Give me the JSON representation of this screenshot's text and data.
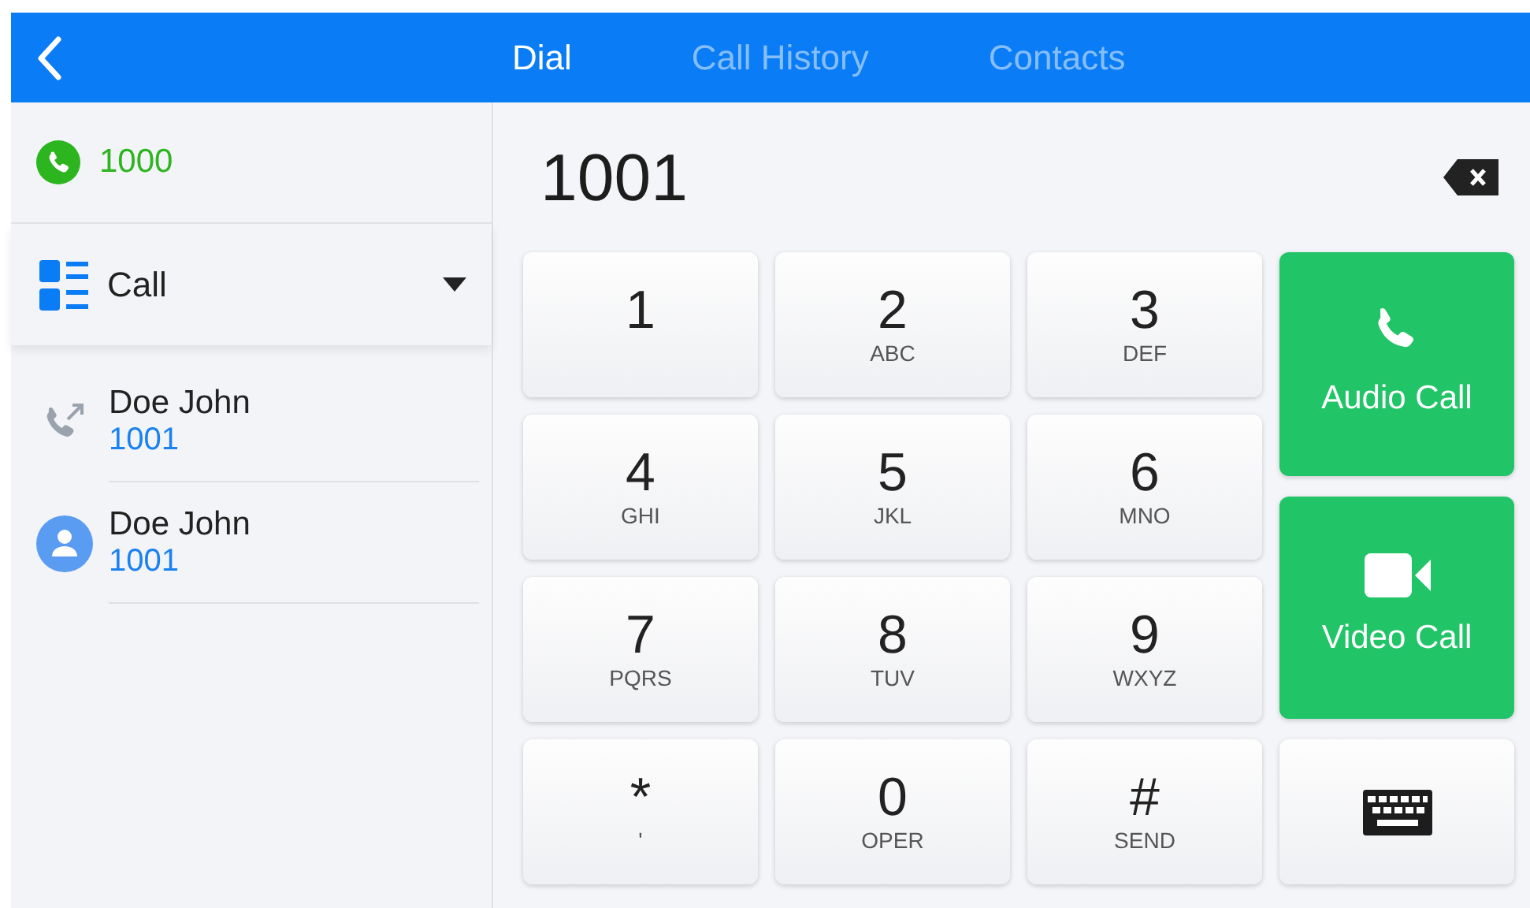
{
  "tabs": [
    {
      "label": "Dial",
      "selected": true
    },
    {
      "label": "Call History",
      "selected": false
    },
    {
      "label": "Contacts",
      "selected": false
    }
  ],
  "account": {
    "number": "1000"
  },
  "mode": {
    "label": "Call"
  },
  "recent": [
    {
      "kind": "history",
      "name": "Doe John",
      "number": "1001"
    },
    {
      "kind": "contact",
      "name": "Doe John",
      "number": "1001"
    }
  ],
  "dial_input": {
    "value": "1001"
  },
  "keys": [
    {
      "digit": "1"
    },
    {
      "digit": "2",
      "letters": "ABC"
    },
    {
      "digit": "3",
      "letters": "DEF"
    },
    {
      "digit": "4",
      "letters": "GHI"
    },
    {
      "digit": "5",
      "letters": "JKL"
    },
    {
      "digit": "6",
      "letters": "MNO"
    },
    {
      "digit": "7",
      "letters": "PQRS"
    },
    {
      "digit": "8",
      "letters": "TUV"
    },
    {
      "digit": "9",
      "letters": "WXYZ"
    },
    {
      "digit": "*",
      "letters": "'"
    },
    {
      "digit": "0",
      "letters": "OPER"
    },
    {
      "digit": "#",
      "letters": "SEND"
    }
  ],
  "actions": [
    {
      "kind": "audio",
      "label": "Audio Call"
    },
    {
      "kind": "video",
      "label": "Video Call"
    },
    {
      "kind": "keyboard"
    }
  ]
}
